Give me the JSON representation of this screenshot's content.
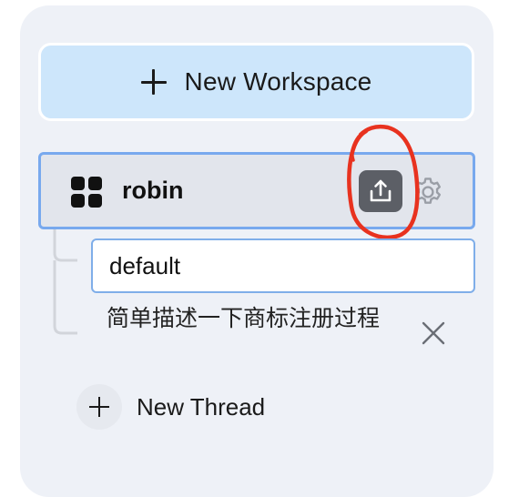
{
  "sidebar": {
    "new_workspace_label": "New Workspace",
    "workspace": {
      "name": "robin",
      "icon": "grid-icon",
      "actions": [
        "upload-icon",
        "gear-icon"
      ]
    },
    "threads": [
      {
        "label": "default",
        "selected": true
      },
      {
        "label": "简单描述一下商标注册过程",
        "selected": false
      }
    ],
    "new_thread_label": "New Thread"
  },
  "colors": {
    "panel_bg": "#eef1f7",
    "new_workspace_bg": "#cde6fb",
    "selected_border": "#78a9ee",
    "annotation_red": "#e8321f"
  }
}
